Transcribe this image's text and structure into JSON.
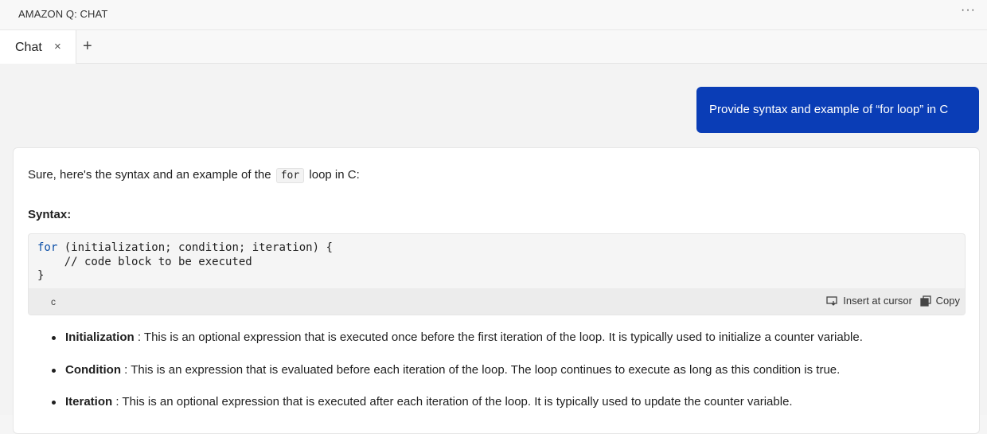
{
  "panel": {
    "title": "AMAZON Q: CHAT",
    "more_label": "···"
  },
  "tabs": [
    {
      "label": "Chat",
      "close_label": "×"
    }
  ],
  "tab_add_label": "+",
  "user_message": "Provide syntax and example of “for loop” in C",
  "reply": {
    "intro_before": "Sure, here's the syntax and an example of the",
    "intro_code": "for",
    "intro_after": "loop in C:",
    "syntax_heading": "Syntax:",
    "code": {
      "keyword": "for",
      "line1_rest": " (initialization; condition; iteration) {",
      "line2": "    // code block to be executed",
      "line3": "}",
      "language": "c",
      "insert_label": "Insert at cursor",
      "copy_label": "Copy"
    },
    "bullets": [
      {
        "term": "Initialization",
        "text": " : This is an optional expression that is executed once before the first iteration of the loop. It is typically used to initialize a counter variable."
      },
      {
        "term": "Condition",
        "text": " : This is an expression that is evaluated before each iteration of the loop. The loop continues to execute as long as this condition is true."
      },
      {
        "term": "Iteration",
        "text": " : This is an optional expression that is executed after each iteration of the loop. It is typically used to update the counter variable."
      }
    ]
  },
  "colors": {
    "user_bubble": "#0a3db6",
    "code_keyword": "#0b4fa8"
  }
}
